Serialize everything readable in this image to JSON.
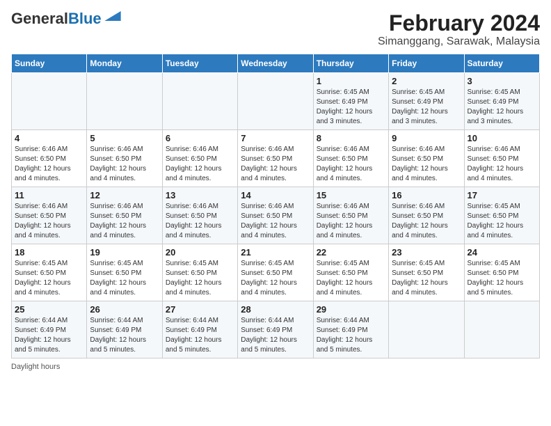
{
  "header": {
    "logo_line1": "General",
    "logo_line2": "Blue",
    "title": "February 2024",
    "subtitle": "Simanggang, Sarawak, Malaysia"
  },
  "days_of_week": [
    "Sunday",
    "Monday",
    "Tuesday",
    "Wednesday",
    "Thursday",
    "Friday",
    "Saturday"
  ],
  "weeks": [
    {
      "days": [
        {
          "num": "",
          "info": ""
        },
        {
          "num": "",
          "info": ""
        },
        {
          "num": "",
          "info": ""
        },
        {
          "num": "",
          "info": ""
        },
        {
          "num": "1",
          "info": "Sunrise: 6:45 AM\nSunset: 6:49 PM\nDaylight: 12 hours\nand 3 minutes."
        },
        {
          "num": "2",
          "info": "Sunrise: 6:45 AM\nSunset: 6:49 PM\nDaylight: 12 hours\nand 3 minutes."
        },
        {
          "num": "3",
          "info": "Sunrise: 6:45 AM\nSunset: 6:49 PM\nDaylight: 12 hours\nand 3 minutes."
        }
      ]
    },
    {
      "days": [
        {
          "num": "4",
          "info": "Sunrise: 6:46 AM\nSunset: 6:50 PM\nDaylight: 12 hours\nand 4 minutes."
        },
        {
          "num": "5",
          "info": "Sunrise: 6:46 AM\nSunset: 6:50 PM\nDaylight: 12 hours\nand 4 minutes."
        },
        {
          "num": "6",
          "info": "Sunrise: 6:46 AM\nSunset: 6:50 PM\nDaylight: 12 hours\nand 4 minutes."
        },
        {
          "num": "7",
          "info": "Sunrise: 6:46 AM\nSunset: 6:50 PM\nDaylight: 12 hours\nand 4 minutes."
        },
        {
          "num": "8",
          "info": "Sunrise: 6:46 AM\nSunset: 6:50 PM\nDaylight: 12 hours\nand 4 minutes."
        },
        {
          "num": "9",
          "info": "Sunrise: 6:46 AM\nSunset: 6:50 PM\nDaylight: 12 hours\nand 4 minutes."
        },
        {
          "num": "10",
          "info": "Sunrise: 6:46 AM\nSunset: 6:50 PM\nDaylight: 12 hours\nand 4 minutes."
        }
      ]
    },
    {
      "days": [
        {
          "num": "11",
          "info": "Sunrise: 6:46 AM\nSunset: 6:50 PM\nDaylight: 12 hours\nand 4 minutes."
        },
        {
          "num": "12",
          "info": "Sunrise: 6:46 AM\nSunset: 6:50 PM\nDaylight: 12 hours\nand 4 minutes."
        },
        {
          "num": "13",
          "info": "Sunrise: 6:46 AM\nSunset: 6:50 PM\nDaylight: 12 hours\nand 4 minutes."
        },
        {
          "num": "14",
          "info": "Sunrise: 6:46 AM\nSunset: 6:50 PM\nDaylight: 12 hours\nand 4 minutes."
        },
        {
          "num": "15",
          "info": "Sunrise: 6:46 AM\nSunset: 6:50 PM\nDaylight: 12 hours\nand 4 minutes."
        },
        {
          "num": "16",
          "info": "Sunrise: 6:46 AM\nSunset: 6:50 PM\nDaylight: 12 hours\nand 4 minutes."
        },
        {
          "num": "17",
          "info": "Sunrise: 6:45 AM\nSunset: 6:50 PM\nDaylight: 12 hours\nand 4 minutes."
        }
      ]
    },
    {
      "days": [
        {
          "num": "18",
          "info": "Sunrise: 6:45 AM\nSunset: 6:50 PM\nDaylight: 12 hours\nand 4 minutes."
        },
        {
          "num": "19",
          "info": "Sunrise: 6:45 AM\nSunset: 6:50 PM\nDaylight: 12 hours\nand 4 minutes."
        },
        {
          "num": "20",
          "info": "Sunrise: 6:45 AM\nSunset: 6:50 PM\nDaylight: 12 hours\nand 4 minutes."
        },
        {
          "num": "21",
          "info": "Sunrise: 6:45 AM\nSunset: 6:50 PM\nDaylight: 12 hours\nand 4 minutes."
        },
        {
          "num": "22",
          "info": "Sunrise: 6:45 AM\nSunset: 6:50 PM\nDaylight: 12 hours\nand 4 minutes."
        },
        {
          "num": "23",
          "info": "Sunrise: 6:45 AM\nSunset: 6:50 PM\nDaylight: 12 hours\nand 4 minutes."
        },
        {
          "num": "24",
          "info": "Sunrise: 6:45 AM\nSunset: 6:50 PM\nDaylight: 12 hours\nand 5 minutes."
        }
      ]
    },
    {
      "days": [
        {
          "num": "25",
          "info": "Sunrise: 6:44 AM\nSunset: 6:49 PM\nDaylight: 12 hours\nand 5 minutes."
        },
        {
          "num": "26",
          "info": "Sunrise: 6:44 AM\nSunset: 6:49 PM\nDaylight: 12 hours\nand 5 minutes."
        },
        {
          "num": "27",
          "info": "Sunrise: 6:44 AM\nSunset: 6:49 PM\nDaylight: 12 hours\nand 5 minutes."
        },
        {
          "num": "28",
          "info": "Sunrise: 6:44 AM\nSunset: 6:49 PM\nDaylight: 12 hours\nand 5 minutes."
        },
        {
          "num": "29",
          "info": "Sunrise: 6:44 AM\nSunset: 6:49 PM\nDaylight: 12 hours\nand 5 minutes."
        },
        {
          "num": "",
          "info": ""
        },
        {
          "num": "",
          "info": ""
        }
      ]
    }
  ],
  "footer": {
    "note": "Daylight hours"
  }
}
